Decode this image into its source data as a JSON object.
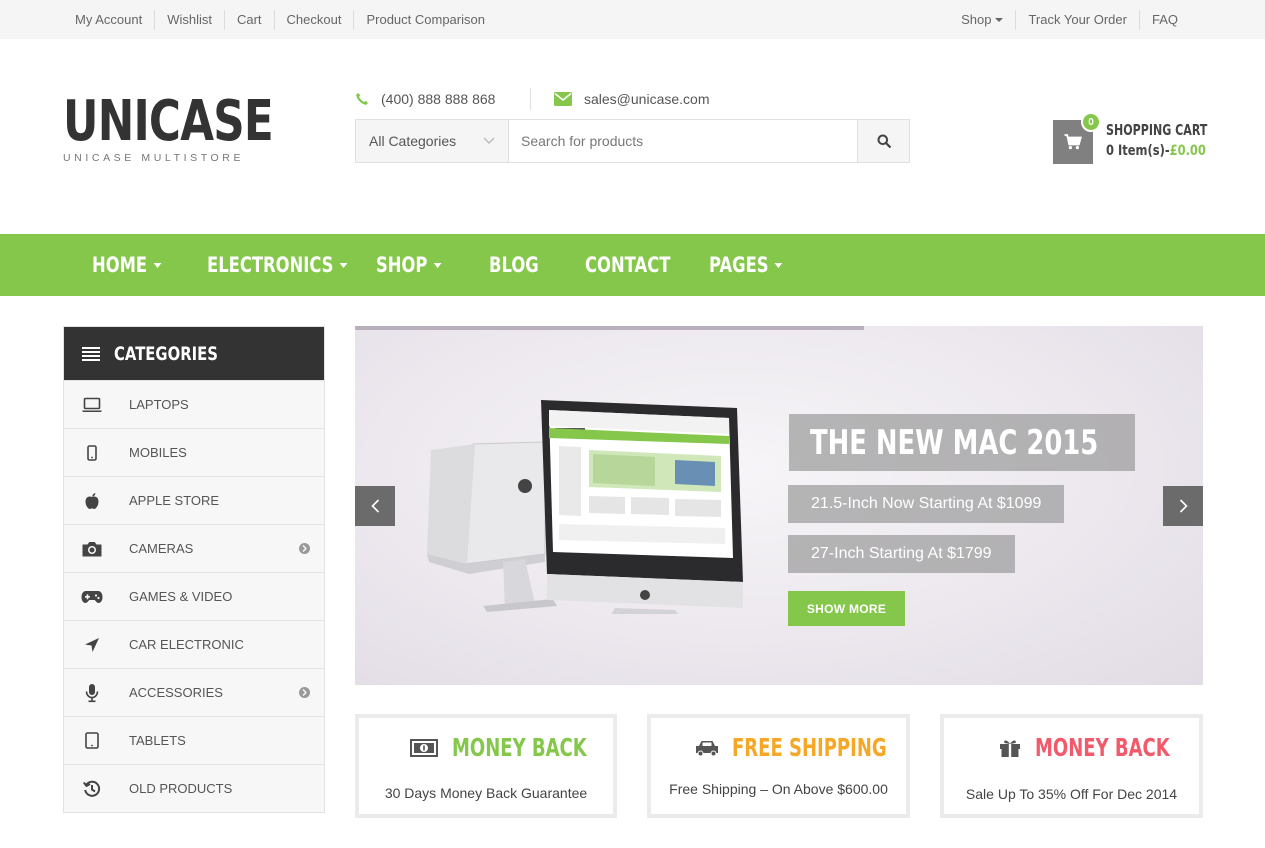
{
  "topbar": {
    "left_links": [
      "My Account",
      "Wishlist",
      "Cart",
      "Checkout",
      "Product Comparison"
    ],
    "right_links": [
      {
        "label": "Shop",
        "dropdown": true
      },
      {
        "label": "Track Your Order",
        "dropdown": false
      },
      {
        "label": "FAQ",
        "dropdown": false
      }
    ]
  },
  "logo": {
    "main": "UNICASE",
    "sub": "UNICASE MULTISTORE"
  },
  "contact": {
    "phone": "(400) 888 888 868",
    "email": "sales@unicase.com"
  },
  "search": {
    "category": "All Categories",
    "placeholder": "Search for products"
  },
  "cart": {
    "count": "0",
    "title": "SHOPPING CART",
    "items": "0 Item(s)-",
    "amount": "£0.00"
  },
  "nav": {
    "items": [
      {
        "label": "HOME",
        "dropdown": true
      },
      {
        "label": "ELECTRONICS",
        "dropdown": true
      },
      {
        "label": "SHOP",
        "dropdown": true
      },
      {
        "label": "BLOG",
        "dropdown": false
      },
      {
        "label": "CONTACT",
        "dropdown": false
      },
      {
        "label": "PAGES",
        "dropdown": true
      }
    ]
  },
  "sidebar": {
    "title": "CATEGORIES",
    "items": [
      {
        "label": "LAPTOPS",
        "icon": "laptop-icon",
        "submenu": false
      },
      {
        "label": "MOBILES",
        "icon": "mobile-icon",
        "submenu": false
      },
      {
        "label": "APPLE STORE",
        "icon": "apple-icon",
        "submenu": false
      },
      {
        "label": "CAMERAS",
        "icon": "camera-icon",
        "submenu": true
      },
      {
        "label": "GAMES & VIDEO",
        "icon": "gamepad-icon",
        "submenu": false
      },
      {
        "label": "CAR ELECTRONIC",
        "icon": "location-arrow-icon",
        "submenu": false
      },
      {
        "label": "ACCESSORIES",
        "icon": "microphone-icon",
        "submenu": true
      },
      {
        "label": "TABLETS",
        "icon": "tablet-icon",
        "submenu": false
      },
      {
        "label": "OLD PRODUCTS",
        "icon": "history-icon",
        "submenu": false
      }
    ]
  },
  "slider": {
    "title": "THE NEW MAC 2015",
    "line1": "21.5-Inch Now Starting At $1099",
    "line2": "27-Inch Starting At $1799",
    "button": "SHOW MORE",
    "progress": 0.6
  },
  "features": [
    {
      "title": "MONEY BACK",
      "subtitle": "30 Days Money Back Guarantee",
      "color": "#84c74b",
      "icon": "money-icon"
    },
    {
      "title": "FREE SHIPPING",
      "subtitle": "Free Shipping – On Above $600.00",
      "color": "#f7a726",
      "icon": "car-icon"
    },
    {
      "title": "MONEY BACK",
      "subtitle": "Sale Up To 35% Off For Dec 2014",
      "color": "#f2596b",
      "icon": "gift-icon"
    }
  ],
  "colors": {
    "accent": "#84c74b",
    "dark": "#333333",
    "topbar": "#f5f5f5"
  }
}
